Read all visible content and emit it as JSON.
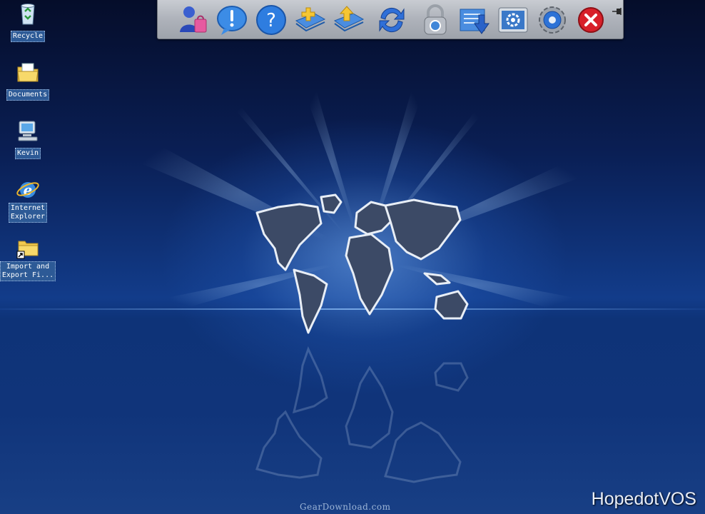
{
  "desktop": {
    "icons": [
      {
        "label": "Recycle",
        "icon": "recycle-bin-icon"
      },
      {
        "label": "Documents",
        "icon": "documents-folder-icon"
      },
      {
        "label": "Kevin",
        "icon": "my-computer-icon"
      },
      {
        "label_line1": "Internet",
        "label_line2": "Explorer",
        "icon": "internet-explorer-icon"
      },
      {
        "label_line1": "Import and",
        "label_line2": "Export Fi...",
        "icon": "folder-shortcut-icon"
      }
    ]
  },
  "toolbar": {
    "buttons": [
      {
        "icon": "user-shopping-icon"
      },
      {
        "icon": "exclamation-info-icon"
      },
      {
        "icon": "help-question-icon"
      },
      {
        "icon": "new-folder-icon"
      },
      {
        "icon": "upload-folder-icon"
      },
      {
        "icon": "refresh-sync-icon"
      },
      {
        "icon": "lock-icon"
      },
      {
        "icon": "download-icon"
      },
      {
        "icon": "control-panel-icon"
      },
      {
        "icon": "settings-gear-icon"
      },
      {
        "icon": "close-icon"
      }
    ],
    "pin_icon": "pin-icon"
  },
  "wallpaper": {
    "watermark": "GearDownload.com",
    "brand": "HopedotVOS"
  },
  "colors": {
    "accent": "#1b4fa8",
    "label_bg": "#2d5a96",
    "toolbar_bg": "#aeb2ba",
    "close_red": "#d8202a"
  }
}
